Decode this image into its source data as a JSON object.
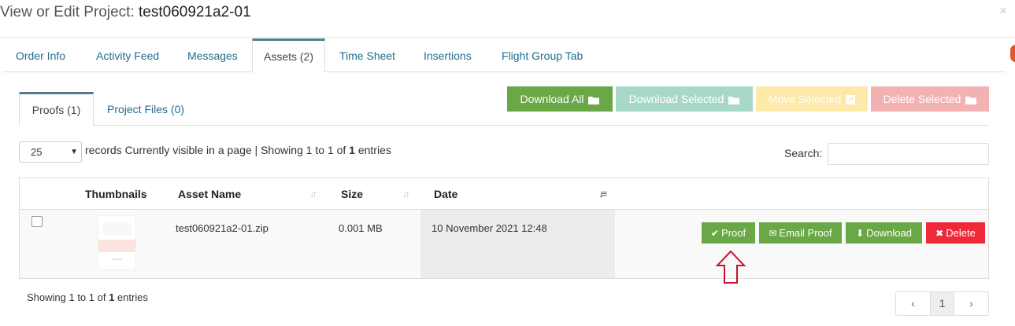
{
  "modal": {
    "title_prefix": "View or Edit Project:",
    "project_name": "test060921a2-01",
    "close_label": "×"
  },
  "tabs": [
    {
      "label": "Order Info"
    },
    {
      "label": "Activity Feed"
    },
    {
      "label": "Messages"
    },
    {
      "label": "Assets (2)"
    },
    {
      "label": "Time Sheet"
    },
    {
      "label": "Insertions"
    },
    {
      "label": "Flight Group Tab"
    }
  ],
  "active_tab": "Assets (2)",
  "subtabs": [
    {
      "label": "Proofs (1)"
    },
    {
      "label": "Project Files (0)"
    }
  ],
  "active_subtab": "Proofs (1)",
  "toolbar": {
    "download_all": "Download All",
    "download_selected": "Download Selected",
    "move_selected": "Move Selected",
    "delete_selected": "Delete Selected",
    "icons": [
      "folder-icon",
      "folder-icon",
      "external-link-icon",
      "folder-icon"
    ]
  },
  "table_controls": {
    "page_length": "25",
    "records_text": "records Currently visible in a page | Showing 1 to 1 of ",
    "records_count": "1",
    "records_suffix": " entries",
    "search_label": "Search:",
    "search_value": ""
  },
  "table": {
    "columns": [
      "Thumbnails",
      "Asset Name",
      "Size",
      "Date"
    ],
    "sorted_column": "Date",
    "rows": [
      {
        "checked": false,
        "asset_name": "test060921a2-01.zip",
        "size": "0.001 MB",
        "date": "10 November 2021 12:48",
        "actions": {
          "proof": "Proof",
          "email_proof": "Email Proof",
          "download": "Download",
          "delete": "Delete"
        }
      }
    ]
  },
  "footer": {
    "info_prefix": "Showing 1 to 1 of ",
    "info_count": "1",
    "info_suffix": " entries",
    "pagination": {
      "prev": "‹",
      "current": "1",
      "next": "›"
    }
  },
  "colors": {
    "success": "#6aa847",
    "danger": "#ee2a38",
    "tab_link": "#1f6e8c",
    "annotation_arrow": "#c8102e"
  }
}
